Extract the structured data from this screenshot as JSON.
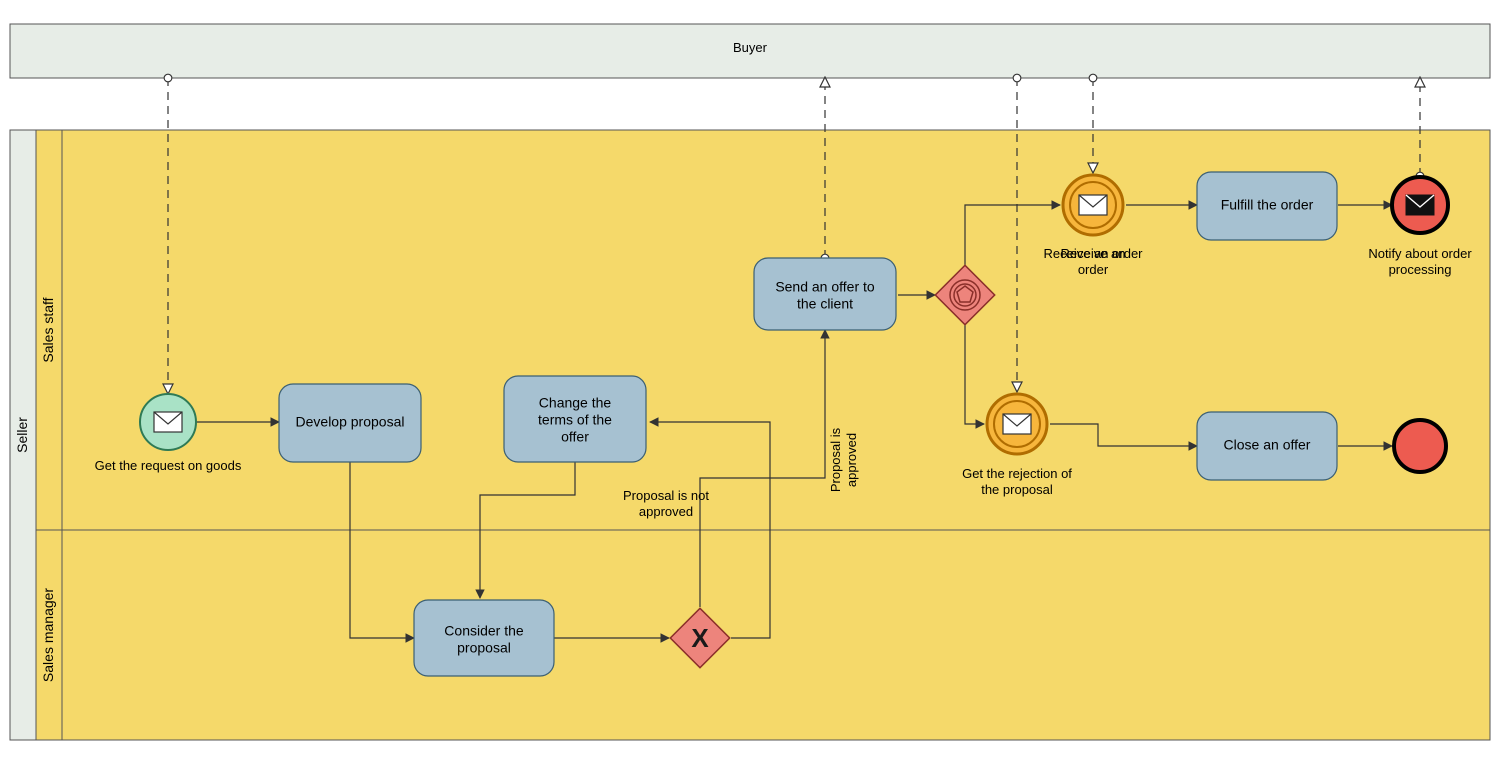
{
  "pool_buyer": "Buyer",
  "pool_seller": "Seller",
  "lane_staff": "Sales staff",
  "lane_manager": "Sales manager",
  "events": {
    "start": "Get the request on goods",
    "receive_order": "Receive an order",
    "rejection": "Get the rejection of the proposal",
    "end_msg": "Notify about order processing"
  },
  "tasks": {
    "develop": "Develop proposal",
    "change": "Change the terms of the offer",
    "send_offer": "Send an offer to the client",
    "fulfill": "Fulfill the order",
    "close": "Close an offer",
    "consider": "Consider the proposal"
  },
  "labels": {
    "not_approved": "Proposal is not approved",
    "approved": "Proposal is approved"
  }
}
